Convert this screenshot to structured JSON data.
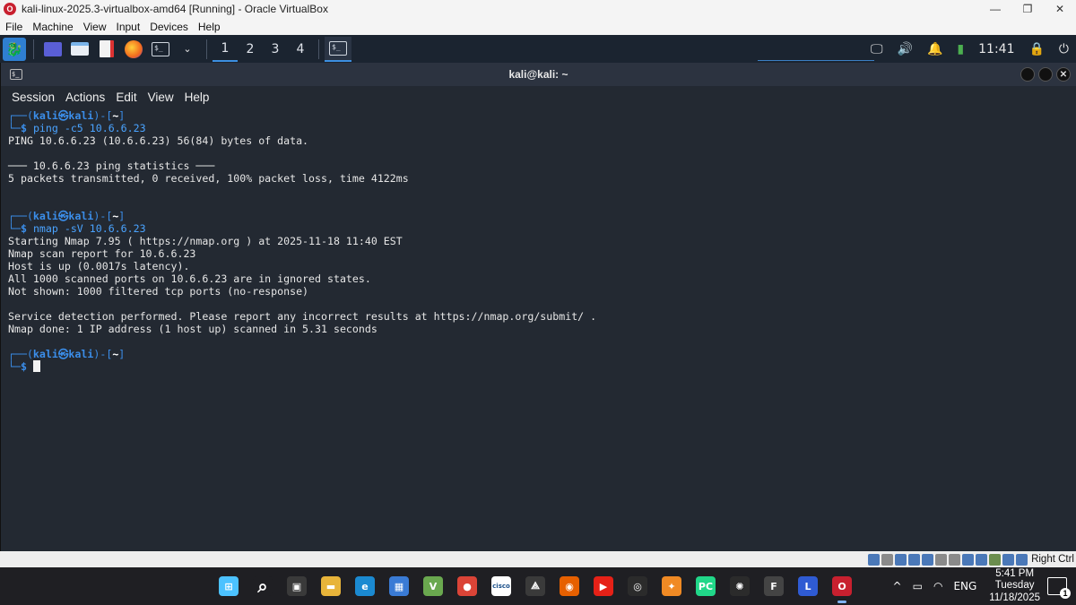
{
  "vbox": {
    "title": "kali-linux-2025.3-virtualbox-amd64 [Running] - Oracle VirtualBox",
    "icon_letter": "O",
    "controls": {
      "minimize": "—",
      "restore": "❐",
      "close": "✕"
    },
    "menu": [
      "File",
      "Machine",
      "View",
      "Input",
      "Devices",
      "Help"
    ],
    "status_right": "Right Ctrl"
  },
  "kali_panel": {
    "workspaces": [
      "1",
      "2",
      "3",
      "4"
    ],
    "active_workspace": "1",
    "terminal_glyph": "$_",
    "clock": "11:41",
    "accent": "#3c8fe0"
  },
  "terminal": {
    "window_title": "kali@kali: ~",
    "menu": [
      "Session",
      "Actions",
      "Edit",
      "View",
      "Help"
    ],
    "prompt": {
      "frame_top_left": "┌──(",
      "user": "kali㉿kali",
      "frame_top_right": ")-[",
      "dir": "~",
      "frame_close": "]",
      "frame_bottom": "└─",
      "dollar": "$"
    },
    "blocks": [
      {
        "command": "ping -c5 10.6.6.23",
        "output": [
          "PING 10.6.6.23 (10.6.6.23) 56(84) bytes of data.",
          "",
          "─── 10.6.6.23 ping statistics ───",
          "5 packets transmitted, 0 received, 100% packet loss, time 4122ms",
          "",
          ""
        ]
      },
      {
        "command": "nmap -sV 10.6.6.23",
        "output": [
          "Starting Nmap 7.95 ( https://nmap.org ) at 2025-11-18 11:40 EST",
          "Nmap scan report for 10.6.6.23",
          "Host is up (0.0017s latency).",
          "All 1000 scanned ports on 10.6.6.23 are in ignored states.",
          "Not shown: 1000 filtered tcp ports (no-response)",
          "",
          "Service detection performed. Please report any incorrect results at https://nmap.org/submit/ .",
          "Nmap done: 1 IP address (1 host up) scanned in 5.31 seconds",
          ""
        ]
      }
    ]
  },
  "taskbar": {
    "apps": [
      {
        "name": "start-icon",
        "glyph": "⊞",
        "color": "#4cc2ff"
      },
      {
        "name": "search-icon",
        "glyph": "⌕",
        "color": "#1f1f23"
      },
      {
        "name": "task-view-icon",
        "glyph": "▣",
        "color": "#3a3a3a"
      },
      {
        "name": "file-explorer-icon",
        "glyph": "▬",
        "color": "#e8b43a"
      },
      {
        "name": "edge-icon",
        "glyph": "e",
        "color": "#1b8ad1"
      },
      {
        "name": "store-icon",
        "glyph": "▦",
        "color": "#3a7bd5"
      },
      {
        "name": "vmware-icon",
        "glyph": "V",
        "color": "#6aa84f"
      },
      {
        "name": "chrome-icon",
        "glyph": "●",
        "color": "#db4437"
      },
      {
        "name": "cisco-icon",
        "glyph": "cisco",
        "color": "#ffffff"
      },
      {
        "name": "network-icon",
        "glyph": "⟁",
        "color": "#3a3a3a"
      },
      {
        "name": "firefox-icon",
        "glyph": "◉",
        "color": "#e66000"
      },
      {
        "name": "youtube-icon",
        "glyph": "▶",
        "color": "#e62117"
      },
      {
        "name": "obs-icon",
        "glyph": "◎",
        "color": "#2b2b2b"
      },
      {
        "name": "butterfly-icon",
        "glyph": "✦",
        "color": "#f08a24"
      },
      {
        "name": "pycharm-icon",
        "glyph": "PC",
        "color": "#21d789"
      },
      {
        "name": "chatgpt-icon",
        "glyph": "✺",
        "color": "#2b2b2b"
      },
      {
        "name": "f-app-icon",
        "glyph": "F",
        "color": "#444444"
      },
      {
        "name": "l-app-icon",
        "glyph": "L",
        "color": "#2f5bd3"
      },
      {
        "name": "virtualbox-icon",
        "glyph": "O",
        "color": "#c8202f"
      }
    ],
    "tray": {
      "chevron": "^",
      "language": "ENG",
      "time": "5:41 PM",
      "day": "Tuesday",
      "date": "11/18/2025",
      "notifications": "1"
    }
  }
}
